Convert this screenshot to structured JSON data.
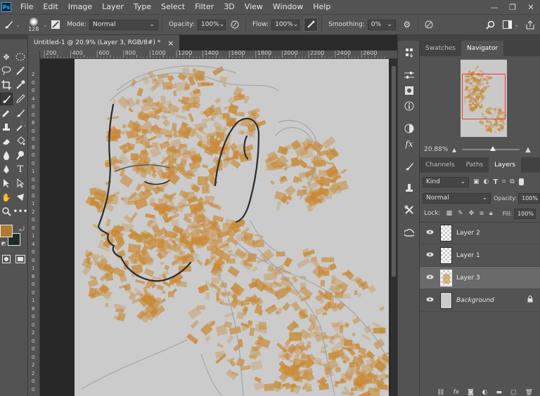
{
  "app": {
    "logo_text": "Ps"
  },
  "menu": [
    "File",
    "Edit",
    "Image",
    "Layer",
    "Type",
    "Select",
    "Filter",
    "3D",
    "View",
    "Window",
    "Help"
  ],
  "window_controls": {
    "minimize": "—",
    "restore": "❐",
    "close": "✕"
  },
  "options_bar": {
    "brush_size": "128",
    "mode_label": "Mode:",
    "mode_value": "Normal",
    "opacity_label": "Opacity:",
    "opacity_value": "100%",
    "flow_label": "Flow:",
    "flow_value": "100%",
    "smoothing_label": "Smoothing:",
    "smoothing_value": "0%"
  },
  "document_tab": {
    "title": "Untitled-1 @ 20.9% (Layer 3, RGB/8#) *",
    "close": "×"
  },
  "ruler_top_ticks": [
    "200",
    "400",
    "600",
    "800",
    "1000",
    "1200",
    "1400",
    "1600",
    "1800",
    "2000",
    "2200",
    "2400",
    "2600"
  ],
  "ruler_left_ticks": [
    "2",
    "0",
    "0",
    "4",
    "0",
    "0",
    "6",
    "0",
    "0",
    "8",
    "0",
    "0",
    "1",
    "0",
    "0",
    "0",
    "1",
    "2",
    "0",
    "0",
    "1",
    "4",
    "0",
    "0",
    "1",
    "6",
    "0",
    "0",
    "1",
    "8",
    "0",
    "0",
    "2",
    "0",
    "0",
    "0",
    "2",
    "2",
    "0",
    "0"
  ],
  "colors": {
    "foreground": "#b07a30",
    "background": "#1f2a2a",
    "paint": "#c98a36",
    "canvas": "#cbcbcb",
    "ui_panel": "#535353",
    "selected_layer": "#6a6a6a",
    "nav_rect": "#ff3030"
  },
  "panels": {
    "top_tabs": [
      "Swatches",
      "Navigator"
    ],
    "top_active": "Navigator",
    "zoom_value": "20.88%",
    "mid_tabs": [
      "Channels",
      "Paths",
      "Layers"
    ],
    "mid_active": "Layers",
    "filter_kind": "Kind",
    "blend_mode": "Normal",
    "opacity_label": "Opacity:",
    "opacity_value": "100%",
    "lock_label": "Lock:",
    "fill_label": "Fill:",
    "fill_value": "100%"
  },
  "layers": [
    {
      "name": "Layer 2",
      "selected": false
    },
    {
      "name": "Layer 1",
      "selected": false
    },
    {
      "name": "Layer 3",
      "selected": true
    },
    {
      "name": "Background",
      "selected": false,
      "locked": true
    }
  ],
  "icons": {
    "brush": "brush-icon",
    "settings": "gear-icon",
    "search": "search-icon",
    "workspace": "workspace-icon",
    "share": "share-icon",
    "airbrush": "airbrush-icon",
    "symmetry": "butterfly-icon",
    "eye": "eye-icon",
    "lock": "lock-icon"
  }
}
